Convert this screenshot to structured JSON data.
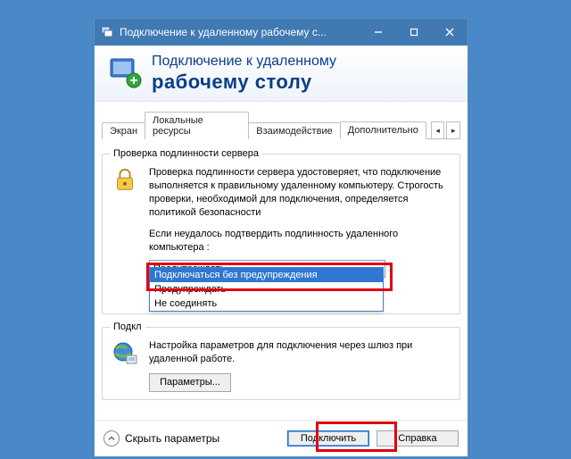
{
  "window": {
    "title": "Подключение к удаленному рабочему с..."
  },
  "header": {
    "line1": "Подключение к удаленному",
    "line2": "рабочему столу"
  },
  "tabs": {
    "items": [
      {
        "label": "Экран"
      },
      {
        "label": "Локальные ресурсы"
      },
      {
        "label": "Взаимодействие"
      },
      {
        "label": "Дополнительно"
      }
    ],
    "active_index": 3,
    "scroll_left": "◂",
    "scroll_right": "▸"
  },
  "group_auth": {
    "legend": "Проверка подлинности сервера",
    "desc": "Проверка подлинности сервера удостоверяет, что подключение выполняется к правильному удаленному компьютеру. Строгость проверки, необходимой для подключения, определяется политикой безопасности",
    "prompt": "Если неудалось подтвердить подлинность удаленного компьютера :",
    "combo": {
      "value": "Предупреждать"
    },
    "dropdown": {
      "options": [
        "Подключаться без предупреждения",
        "Предупреждать",
        "Не соединять"
      ],
      "selected_index": 0
    }
  },
  "group_gateway": {
    "legend": "Подкл",
    "desc": "Настройка параметров для подключения через шлюз при удаленной работе.",
    "button": "Параметры..."
  },
  "footer": {
    "hide": "Скрыть параметры",
    "connect": "Подключить",
    "help": "Справка"
  }
}
